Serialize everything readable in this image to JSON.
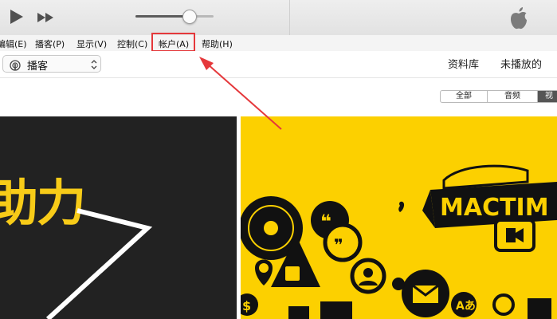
{
  "menu": {
    "items": [
      "编辑(E)",
      "播客(P)",
      "显示(V)",
      "控制(C)",
      "帐户(A)",
      "帮助(H)"
    ]
  },
  "library": {
    "selector_label": "播客",
    "tabs": [
      "资料库",
      "未播放的"
    ]
  },
  "filter": {
    "segments": [
      "全部",
      "音频",
      "视"
    ]
  },
  "artwork": {
    "left_title": "助力",
    "right_banner": "MACTIM"
  },
  "colors": {
    "highlight": "#e5383b",
    "yellow": "#fcd000",
    "dark": "#222222"
  },
  "icons": [
    "play-icon",
    "fast-forward-icon",
    "apple-logo-icon",
    "podcast-icon",
    "updown-chevron-icon"
  ]
}
